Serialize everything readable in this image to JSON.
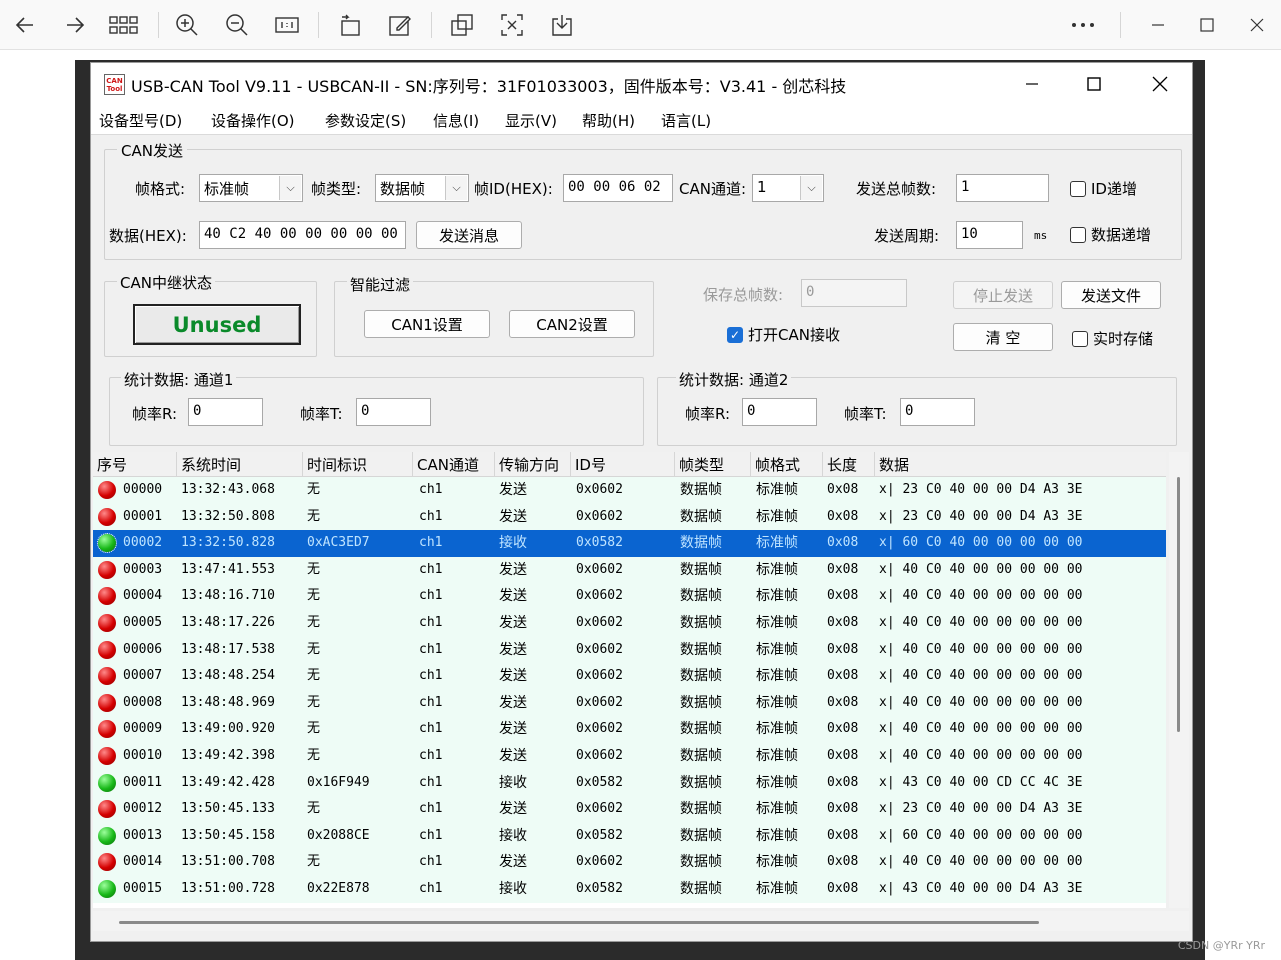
{
  "viewer": {
    "icons": [
      "back-arrow-icon",
      "forward-arrow-icon",
      "grid-icon",
      "zoom-in-icon",
      "zoom-out-icon",
      "actual-size-icon",
      "rotate-icon",
      "edit-icon",
      "crop-icon",
      "translate-icon",
      "save-icon",
      "more-icon",
      "minimize-icon",
      "maximize-icon",
      "close-icon"
    ],
    "watermark": "CSDN @YRr YRr"
  },
  "window": {
    "icon_text": "CAN Tool",
    "title": "USB-CAN Tool V9.11 - USBCAN-II - SN:序列号：31F01033003，固件版本号：V3.41 - 创芯科技"
  },
  "menu": [
    "设备型号(D)",
    "设备操作(O)",
    "参数设定(S)",
    "信息(I)",
    "显示(V)",
    "帮助(H)",
    "语言(L)"
  ],
  "can_send": {
    "title": "CAN发送",
    "frame_format_label": "帧格式:",
    "frame_format_value": "标准帧",
    "frame_type_label": "帧类型:",
    "frame_type_value": "数据帧",
    "frame_id_label": "帧ID(HEX):",
    "frame_id_value": "00 00 06 02",
    "channel_label": "CAN通道:",
    "channel_value": "1",
    "total_frames_label": "发送总帧数:",
    "total_frames_value": "1",
    "id_increment_label": "ID递增",
    "data_label": "数据(HEX):",
    "data_value": "40 C2 40 00 00 00 00 00",
    "send_button": "发送消息",
    "period_label": "发送周期:",
    "period_value": "10",
    "period_unit": "ms",
    "data_increment_label": "数据递增"
  },
  "relay": {
    "title": "CAN中继状态",
    "status": "Unused"
  },
  "filter": {
    "title": "智能过滤",
    "can1_button": "CAN1设置",
    "can2_button": "CAN2设置"
  },
  "save": {
    "total_frames_label": "保存总帧数:",
    "total_frames_value": "0",
    "stop_button": "停止发送",
    "send_file_button": "发送文件",
    "open_receive_label": "打开CAN接收",
    "clear_button": "清 空",
    "realtime_save_label": "实时存储"
  },
  "stats": [
    {
      "title": "统计数据: 通道1",
      "rate_r_label": "帧率R:",
      "rate_r_value": "0",
      "rate_t_label": "帧率T:",
      "rate_t_value": "0"
    },
    {
      "title": "统计数据: 通道2",
      "rate_r_label": "帧率R:",
      "rate_r_value": "0",
      "rate_t_label": "帧率T:",
      "rate_t_value": "0"
    }
  ],
  "table": {
    "columns": [
      "序号",
      "系统时间",
      "时间标识",
      "CAN通道",
      "传输方向",
      "ID号",
      "帧类型",
      "帧格式",
      "长度",
      "数据"
    ],
    "selected_index": 2,
    "rows": [
      {
        "status": "red",
        "seq": "00000",
        "time": "13:32:43.068",
        "stamp": "无",
        "ch": "ch1",
        "dir": "发送",
        "id": "0x0602",
        "type": "数据帧",
        "fmt": "标准帧",
        "len": "0x08",
        "data": "x| 23 C0 40 00 00 D4 A3 3E"
      },
      {
        "status": "red",
        "seq": "00001",
        "time": "13:32:50.808",
        "stamp": "无",
        "ch": "ch1",
        "dir": "发送",
        "id": "0x0602",
        "type": "数据帧",
        "fmt": "标准帧",
        "len": "0x08",
        "data": "x| 23 C0 40 00 00 D4 A3 3E"
      },
      {
        "status": "green",
        "seq": "00002",
        "time": "13:32:50.828",
        "stamp": "0xAC3ED7",
        "ch": "ch1",
        "dir": "接收",
        "id": "0x0582",
        "type": "数据帧",
        "fmt": "标准帧",
        "len": "0x08",
        "data": "x| 60 C0 40 00 00 00 00 00"
      },
      {
        "status": "red",
        "seq": "00003",
        "time": "13:47:41.553",
        "stamp": "无",
        "ch": "ch1",
        "dir": "发送",
        "id": "0x0602",
        "type": "数据帧",
        "fmt": "标准帧",
        "len": "0x08",
        "data": "x| 40 C0 40 00 00 00 00 00"
      },
      {
        "status": "red",
        "seq": "00004",
        "time": "13:48:16.710",
        "stamp": "无",
        "ch": "ch1",
        "dir": "发送",
        "id": "0x0602",
        "type": "数据帧",
        "fmt": "标准帧",
        "len": "0x08",
        "data": "x| 40 C0 40 00 00 00 00 00"
      },
      {
        "status": "red",
        "seq": "00005",
        "time": "13:48:17.226",
        "stamp": "无",
        "ch": "ch1",
        "dir": "发送",
        "id": "0x0602",
        "type": "数据帧",
        "fmt": "标准帧",
        "len": "0x08",
        "data": "x| 40 C0 40 00 00 00 00 00"
      },
      {
        "status": "red",
        "seq": "00006",
        "time": "13:48:17.538",
        "stamp": "无",
        "ch": "ch1",
        "dir": "发送",
        "id": "0x0602",
        "type": "数据帧",
        "fmt": "标准帧",
        "len": "0x08",
        "data": "x| 40 C0 40 00 00 00 00 00"
      },
      {
        "status": "red",
        "seq": "00007",
        "time": "13:48:48.254",
        "stamp": "无",
        "ch": "ch1",
        "dir": "发送",
        "id": "0x0602",
        "type": "数据帧",
        "fmt": "标准帧",
        "len": "0x08",
        "data": "x| 40 C0 40 00 00 00 00 00"
      },
      {
        "status": "red",
        "seq": "00008",
        "time": "13:48:48.969",
        "stamp": "无",
        "ch": "ch1",
        "dir": "发送",
        "id": "0x0602",
        "type": "数据帧",
        "fmt": "标准帧",
        "len": "0x08",
        "data": "x| 40 C0 40 00 00 00 00 00"
      },
      {
        "status": "red",
        "seq": "00009",
        "time": "13:49:00.920",
        "stamp": "无",
        "ch": "ch1",
        "dir": "发送",
        "id": "0x0602",
        "type": "数据帧",
        "fmt": "标准帧",
        "len": "0x08",
        "data": "x| 40 C0 40 00 00 00 00 00"
      },
      {
        "status": "red",
        "seq": "00010",
        "time": "13:49:42.398",
        "stamp": "无",
        "ch": "ch1",
        "dir": "发送",
        "id": "0x0602",
        "type": "数据帧",
        "fmt": "标准帧",
        "len": "0x08",
        "data": "x| 40 C0 40 00 00 00 00 00"
      },
      {
        "status": "green",
        "seq": "00011",
        "time": "13:49:42.428",
        "stamp": "0x16F949",
        "ch": "ch1",
        "dir": "接收",
        "id": "0x0582",
        "type": "数据帧",
        "fmt": "标准帧",
        "len": "0x08",
        "data": "x| 43 C0 40 00 CD CC 4C 3E"
      },
      {
        "status": "red",
        "seq": "00012",
        "time": "13:50:45.133",
        "stamp": "无",
        "ch": "ch1",
        "dir": "发送",
        "id": "0x0602",
        "type": "数据帧",
        "fmt": "标准帧",
        "len": "0x08",
        "data": "x| 23 C0 40 00 00 D4 A3 3E"
      },
      {
        "status": "green",
        "seq": "00013",
        "time": "13:50:45.158",
        "stamp": "0x2088CE",
        "ch": "ch1",
        "dir": "接收",
        "id": "0x0582",
        "type": "数据帧",
        "fmt": "标准帧",
        "len": "0x08",
        "data": "x| 60 C0 40 00 00 00 00 00"
      },
      {
        "status": "red",
        "seq": "00014",
        "time": "13:51:00.708",
        "stamp": "无",
        "ch": "ch1",
        "dir": "发送",
        "id": "0x0602",
        "type": "数据帧",
        "fmt": "标准帧",
        "len": "0x08",
        "data": "x| 40 C0 40 00 00 00 00 00"
      },
      {
        "status": "green",
        "seq": "00015",
        "time": "13:51:00.728",
        "stamp": "0x22E878",
        "ch": "ch1",
        "dir": "接收",
        "id": "0x0582",
        "type": "数据帧",
        "fmt": "标准帧",
        "len": "0x08",
        "data": "x| 43 C0 40 00 00 D4 A3 3E"
      }
    ]
  }
}
